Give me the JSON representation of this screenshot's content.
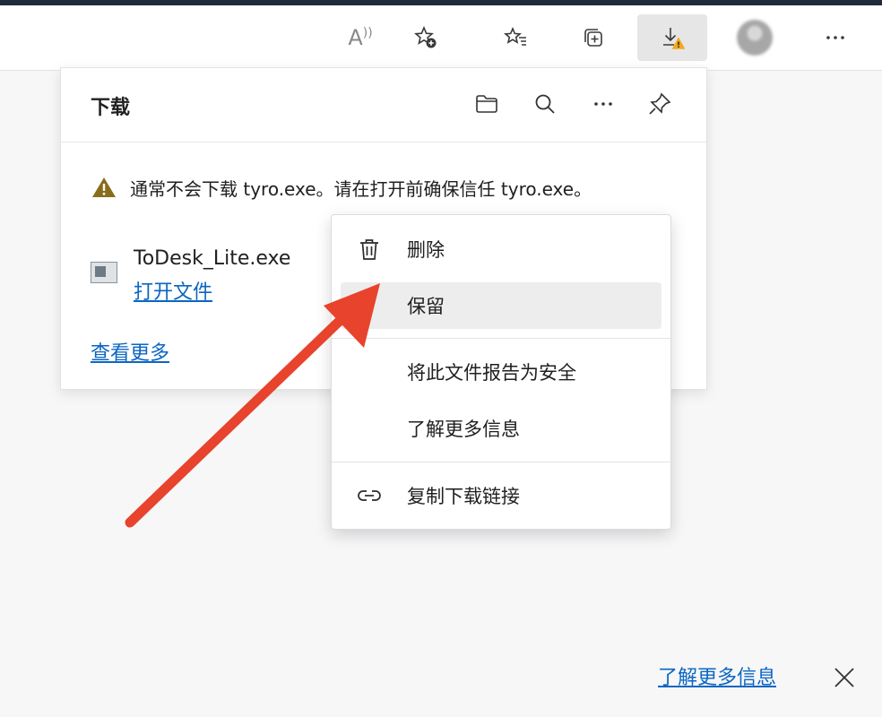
{
  "toolbar": {
    "read_aloud_glyph": "A",
    "read_aloud_superscript": "⁾",
    "icons": [
      "read-aloud-icon",
      "add-favorite-icon",
      "favorites-icon",
      "collections-icon",
      "downloads-icon",
      "profile-avatar",
      "more-icon"
    ]
  },
  "downloads_panel": {
    "title": "下载",
    "header_icons": [
      "open-folder-icon",
      "search-icon",
      "more-icon",
      "pin-icon"
    ],
    "warning_text": "通常不会下载 tyro.exe。请在打开前确保信任 tyro.exe。",
    "file": {
      "name": "ToDesk_Lite.exe",
      "action": "打开文件"
    },
    "see_more": "查看更多"
  },
  "context_menu": {
    "items": [
      {
        "label": "删除",
        "icon": "trash-icon"
      },
      {
        "label": "保留",
        "icon": "",
        "highlighted": true
      },
      {
        "label": "将此文件报告为安全",
        "icon": ""
      },
      {
        "label": "了解更多信息",
        "icon": ""
      },
      {
        "label": "复制下载链接",
        "icon": "link-icon"
      }
    ]
  },
  "footer": {
    "learn_more": "了解更多信息",
    "close_icon": "close-icon"
  },
  "colors": {
    "accent_link": "#0b66c3",
    "warning": "#8a6d1b",
    "annotation_arrow": "#e8432c"
  }
}
